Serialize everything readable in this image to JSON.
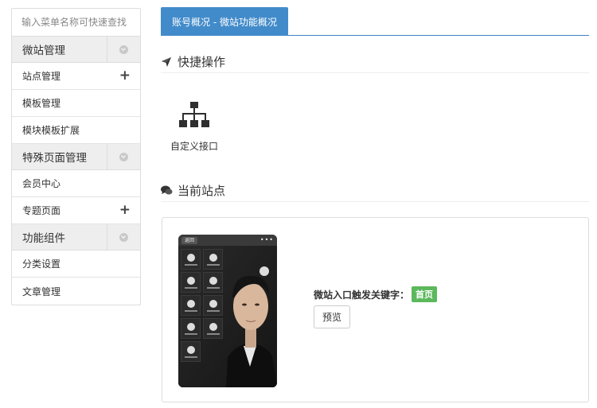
{
  "sidebar": {
    "search_placeholder": "输入菜单名称可快速查找",
    "groups": [
      {
        "title": "微站管理",
        "items": [
          {
            "label": "站点管理",
            "has_plus": true
          },
          {
            "label": "模板管理"
          },
          {
            "label": "模块模板扩展"
          }
        ]
      },
      {
        "title": "特殊页面管理",
        "items": [
          {
            "label": "会员中心"
          },
          {
            "label": "专题页面",
            "has_plus": true
          }
        ]
      },
      {
        "title": "功能组件",
        "items": [
          {
            "label": "分类设置"
          },
          {
            "label": "文章管理"
          }
        ]
      }
    ],
    "plus_glyph": "+"
  },
  "tabs": [
    {
      "label": "账号概况 - 微站功能概况",
      "active": true
    }
  ],
  "quick_actions": {
    "title": "快捷操作",
    "icon": "plane-icon",
    "items": [
      {
        "label": "自定义接口",
        "icon": "sitemap-icon"
      }
    ]
  },
  "current_site": {
    "title": "当前站点",
    "icon": "comments-icon",
    "phone": {
      "back_label": "返回",
      "more_glyph": "•••"
    },
    "keyword_label": "微站入口触发关键字：",
    "keyword_value": "首页",
    "preview_button": "预览"
  },
  "colors": {
    "tab_active": "#428bca",
    "badge_green": "#5cb85c",
    "group_header_bg": "#eeeeee",
    "border": "#dddddd"
  }
}
